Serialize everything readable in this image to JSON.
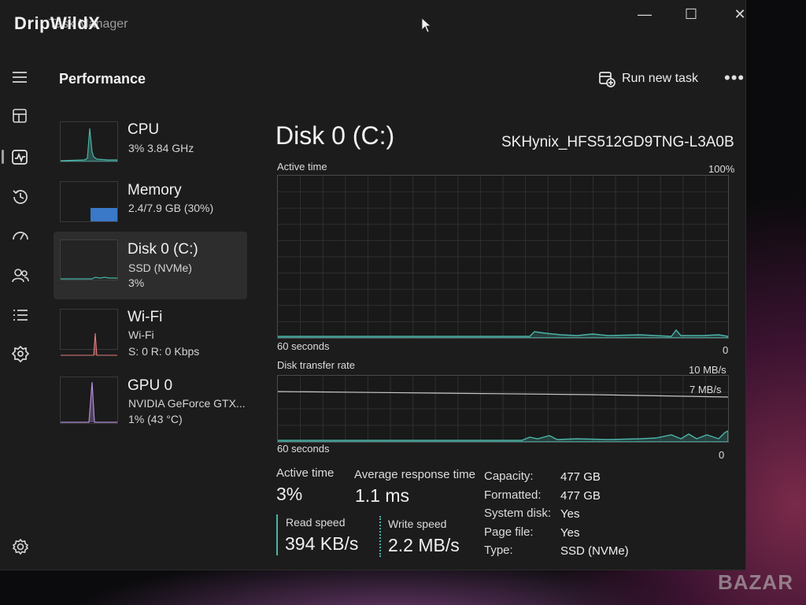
{
  "window": {
    "app_title": "DripWildX",
    "app_title_overlay": "Task Manager",
    "controls": {
      "minimize": "—",
      "maximize": "☐",
      "close": "✕"
    }
  },
  "header": {
    "title": "Performance",
    "run_task_label": "Run new task",
    "more_label": "•••"
  },
  "nav_icons": [
    "menu-icon",
    "processes-icon",
    "performance-icon",
    "app-history-icon",
    "startup-apps-icon",
    "users-icon",
    "details-icon",
    "services-icon",
    "settings-icon"
  ],
  "sidebar": [
    {
      "name": "CPU",
      "sub1": "3%  3.84 GHz",
      "sub2": ""
    },
    {
      "name": "Memory",
      "sub1": "2.4/7.9 GB (30%)",
      "sub2": ""
    },
    {
      "name": "Disk 0 (C:)",
      "sub1": "SSD (NVMe)",
      "sub2": "3%"
    },
    {
      "name": "Wi-Fi",
      "sub1": "Wi-Fi",
      "sub2": "S: 0 R: 0 Kbps"
    },
    {
      "name": "GPU 0",
      "sub1": "NVIDIA GeForce GTX...",
      "sub2": "1% (43 °C)"
    }
  ],
  "main": {
    "disk_title": "Disk 0 (C:)",
    "disk_model": "SKHynix_HFS512GD9TNG-L3A0B",
    "active_graph": {
      "label": "Active time",
      "max_label": "100%",
      "time_label": "60 seconds",
      "min_label": "0"
    },
    "transfer_graph": {
      "label": "Disk transfer rate",
      "max_label": "10 MB/s",
      "mid_label": "7 MB/s",
      "time_label": "60 seconds",
      "min_label": "0"
    },
    "stats": {
      "active_time_label": "Active time",
      "active_time_value": "3%",
      "avg_response_label": "Average response time",
      "avg_response_value": "1.1 ms",
      "read_speed_label": "Read speed",
      "read_speed_value": "394 KB/s",
      "write_speed_label": "Write speed",
      "write_speed_value": "2.2 MB/s"
    },
    "properties": [
      {
        "key": "Capacity:",
        "value": "477 GB"
      },
      {
        "key": "Formatted:",
        "value": "477 GB"
      },
      {
        "key": "System disk:",
        "value": "Yes"
      },
      {
        "key": "Page file:",
        "value": "Yes"
      },
      {
        "key": "Type:",
        "value": "SSD (NVMe)"
      }
    ]
  },
  "watermark": "BAZAR",
  "colors": {
    "accent_teal": "#4bb3a8",
    "memory_blue": "#3a78c8",
    "gpu_purple": "#b08cd8"
  }
}
